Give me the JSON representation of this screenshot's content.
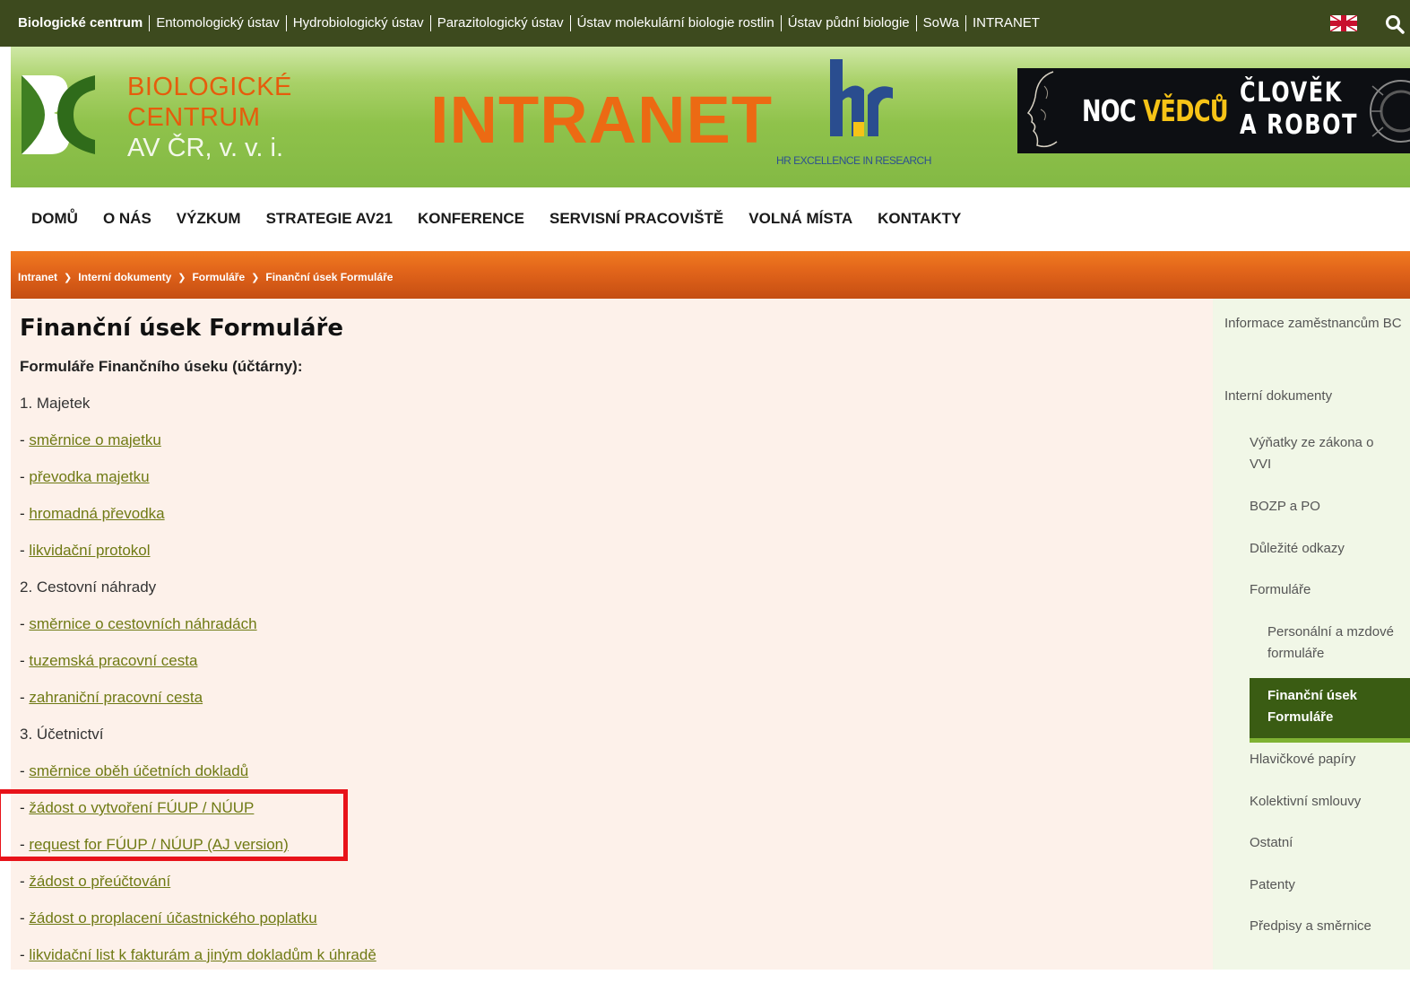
{
  "topbar": {
    "links": [
      "Biologické centrum",
      "Entomologický ústav",
      "Hydrobiologický ústav",
      "Parazitologický ústav",
      "Ústav molekulární biologie rostlin",
      "Ústav půdní biologie",
      "SoWa",
      "INTRANET"
    ]
  },
  "header": {
    "logo_line1": "BIOLOGICKÉ",
    "logo_line2": "CENTRUM",
    "logo_line3": "AV ČR, v. v. i.",
    "title": "INTRANET",
    "hr_caption": "HR EXCELLENCE IN RESEARCH",
    "banner_noc": "NOC ",
    "banner_vedcu": "VĚDCŮ",
    "banner_clovek": "ČLOVĚK",
    "banner_robot": "A ROBOT"
  },
  "nav": [
    "DOMŮ",
    "O NÁS",
    "VÝZKUM",
    "STRATEGIE AV21",
    "KONFERENCE",
    "SERVISNÍ PRACOVIŠTĚ",
    "VOLNÁ MÍSTA",
    "KONTAKTY"
  ],
  "breadcrumb": [
    "Intranet",
    "Interní dokumenty",
    "Formuláře",
    "Finanční úsek Formuláře"
  ],
  "main": {
    "title": "Finanční úsek Formuláře",
    "subtitle": "Formuláře Finančního úseku (účtárny):",
    "items": [
      {
        "type": "section",
        "text": "1. Majetek"
      },
      {
        "type": "link",
        "text": "směrnice o majetku"
      },
      {
        "type": "link",
        "text": "převodka majetku"
      },
      {
        "type": "link",
        "text": "hromadná převodka"
      },
      {
        "type": "link",
        "text": "likvidační protokol"
      },
      {
        "type": "section",
        "text": "2. Cestovní náhrady"
      },
      {
        "type": "link",
        "text": "směrnice o cestovních náhradách"
      },
      {
        "type": "link",
        "text": "tuzemská pracovní cesta"
      },
      {
        "type": "link",
        "text": "zahraniční pracovní cesta"
      },
      {
        "type": "section",
        "text": "3. Účetnictví"
      },
      {
        "type": "link",
        "text": "směrnice oběh účetních dokladů"
      },
      {
        "type": "link",
        "text": "žádost o vytvoření FÚUP / NÚUP"
      },
      {
        "type": "link",
        "text": "request for FÚUP / NÚUP (AJ version)"
      },
      {
        "type": "link",
        "text": "žádost o přeúčtování"
      },
      {
        "type": "link",
        "text": "žádost o proplacení účastnického poplatku"
      },
      {
        "type": "link",
        "text": "likvidační list k fakturám a jiným dokladům k úhradě"
      }
    ]
  },
  "sidebar": {
    "top1": "Informace zaměstnancům BC",
    "top2": "Interní dokumenty",
    "sub_vynatky": "Výňatky ze zákona o VVI",
    "sub_bozp": "BOZP a PO",
    "sub_odkazy": "Důležité odkazy",
    "sub_formulare": "Formuláře",
    "subsub_personalni": "Personální a mzdové formuláře",
    "subsub_active": "Finanční úsek Formuláře",
    "sub_hlavickove": "Hlavičkové papíry",
    "sub_kolektivni": "Kolektivní smlouvy",
    "sub_ostatni": "Ostatní",
    "sub_patenty": "Patenty",
    "sub_predpisy": "Předpisy a směrnice"
  },
  "colors": {
    "topbar_bg": "#3d4a1e",
    "header_green": "#8fc24b",
    "accent_orange": "#ec6a13",
    "link_olive": "#6f7a14",
    "sidebar_active": "#3a5c13",
    "highlight_red": "#e8131a"
  }
}
